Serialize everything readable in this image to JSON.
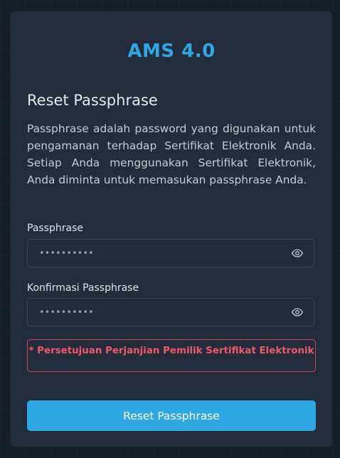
{
  "app": {
    "title": "AMS 4.0"
  },
  "form": {
    "heading": "Reset Passphrase",
    "description": "Passphrase adalah password yang digunakan untuk pengamanan terhadap Sertifikat Elektronik Anda. Setiap Anda menggunakan Sertifikat Elektronik, Anda diminta untuk memasukan passphrase Anda.",
    "passphrase": {
      "label": "Passphrase",
      "value": "••••••••••"
    },
    "confirm": {
      "label": "Konfirmasi Passphrase",
      "value": "••••••••••"
    },
    "warning": "* Persetujuan Perjanjian Pemilik Sertifikat Elektronik",
    "submit_label": "Reset Passphrase"
  },
  "colors": {
    "accent": "#2ea8e2",
    "card": "#232c3d",
    "background": "#161d2a",
    "warning": "#ef5a64"
  },
  "icons": {
    "show_password": "eye-icon"
  }
}
